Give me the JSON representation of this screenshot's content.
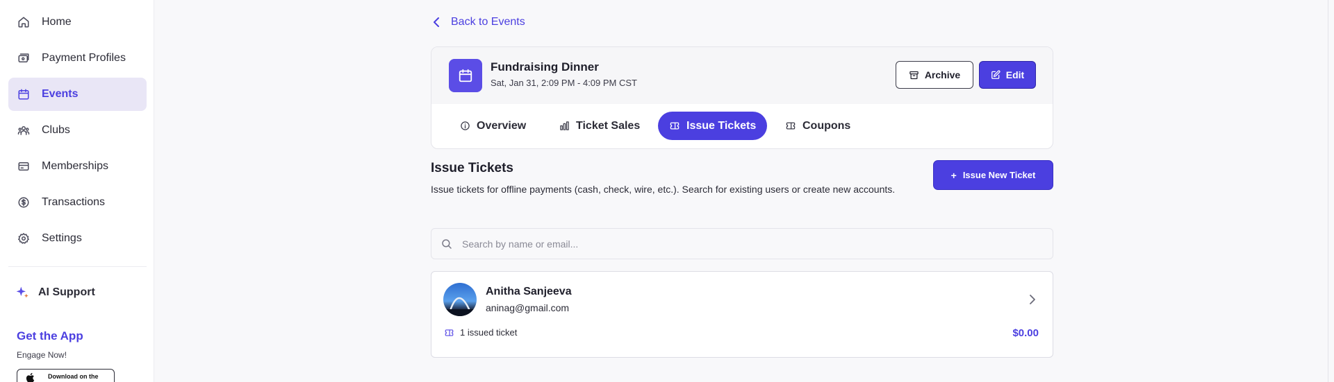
{
  "sidebar": {
    "items": [
      {
        "label": "Home",
        "icon": "home-icon"
      },
      {
        "label": "Payment Profiles",
        "icon": "payment-profiles-icon"
      },
      {
        "label": "Events",
        "icon": "calendar-icon",
        "active": true
      },
      {
        "label": "Clubs",
        "icon": "users-icon"
      },
      {
        "label": "Memberships",
        "icon": "membership-card-icon"
      },
      {
        "label": "Transactions",
        "icon": "dollar-circle-icon"
      },
      {
        "label": "Settings",
        "icon": "gear-icon"
      }
    ],
    "ai_support": "AI Support",
    "app_title": "Get the App",
    "app_subtitle": "Engage Now!",
    "store_badge": "Download on the"
  },
  "back_link": "Back to Events",
  "event": {
    "title": "Fundraising Dinner",
    "time": "Sat, Jan 31, 2:09 PM - 4:09 PM CST",
    "archive_label": "Archive",
    "edit_label": "Edit"
  },
  "tabs": [
    {
      "label": "Overview",
      "icon": "info-icon"
    },
    {
      "label": "Ticket Sales",
      "icon": "bar-chart-icon"
    },
    {
      "label": "Issue Tickets",
      "icon": "ticket-icon",
      "active": true
    },
    {
      "label": "Coupons",
      "icon": "coupon-icon"
    }
  ],
  "section": {
    "title": "Issue Tickets",
    "description": "Issue tickets for offline payments (cash, check, wire, etc.). Search for existing users or create new accounts.",
    "issue_button": "Issue New Ticket"
  },
  "search": {
    "placeholder": "Search by name or email..."
  },
  "person": {
    "name": "Anitha Sanjeeva",
    "email": "aninag@gmail.com",
    "tickets": "1 issued ticket",
    "amount": "$0.00"
  },
  "colors": {
    "accent": "#4b3fe0",
    "active_nav_bg": "#e9e6f6",
    "background": "#f8f8fa"
  }
}
